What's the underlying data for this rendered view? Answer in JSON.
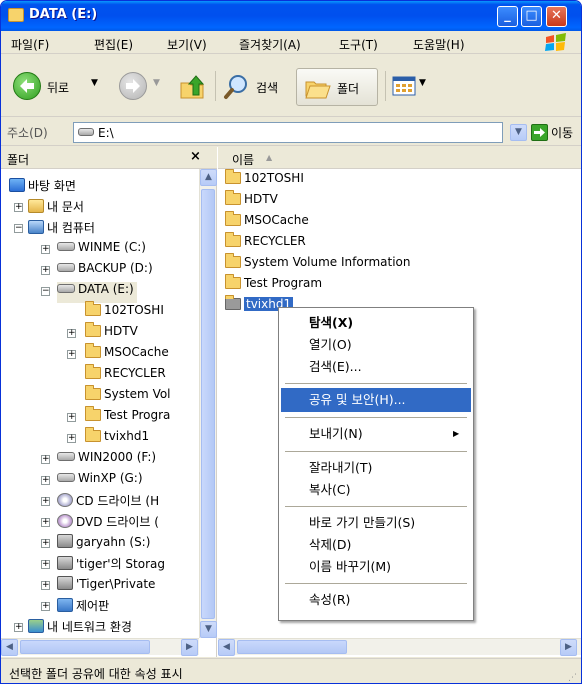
{
  "window": {
    "title": "DATA (E:)"
  },
  "menu": [
    "파일(F)",
    "편집(E)",
    "보기(V)",
    "즐겨찾기(A)",
    "도구(T)",
    "도움말(H)"
  ],
  "toolbar": {
    "back": "뒤로",
    "search": "검색",
    "folders": "폴더"
  },
  "address": {
    "label": "주소(D)",
    "value": "E:\\",
    "go": "이동"
  },
  "folder_pane": {
    "title": "폴더",
    "items": [
      {
        "label": "바탕 화면"
      },
      {
        "label": "내 문서"
      },
      {
        "label": "내 컴퓨터"
      },
      {
        "label": "WINME (C:)"
      },
      {
        "label": "BACKUP (D:)"
      },
      {
        "label": "DATA (E:)"
      },
      {
        "label": "102TOSHI"
      },
      {
        "label": "HDTV"
      },
      {
        "label": "MSOCache"
      },
      {
        "label": "RECYCLER"
      },
      {
        "label": "System Vol"
      },
      {
        "label": "Test Progra"
      },
      {
        "label": "tvixhd1"
      },
      {
        "label": "WIN2000 (F:)"
      },
      {
        "label": "WinXP (G:)"
      },
      {
        "label": "CD 드라이브 (H"
      },
      {
        "label": "DVD 드라이브 ("
      },
      {
        "label": "garyahn (S:)"
      },
      {
        "label": "'tiger'의 Storag"
      },
      {
        "label": "'Tiger\\Private"
      },
      {
        "label": "제어판"
      },
      {
        "label": "내 네트워크 환경"
      }
    ]
  },
  "file_pane": {
    "column_name": "이름",
    "files": [
      "102TOSHI",
      "HDTV",
      "MSOCache",
      "RECYCLER",
      "System Volume Information",
      "Test Program",
      "tvixhd1"
    ]
  },
  "context_menu": {
    "items": [
      "탐색(X)",
      "열기(O)",
      "검색(E)...",
      "공유 및 보안(H)...",
      "보내기(N)",
      "잘라내기(T)",
      "복사(C)",
      "바로 가기 만들기(S)",
      "삭제(D)",
      "이름 바꾸기(M)",
      "속성(R)"
    ]
  },
  "status": {
    "text": "선택한 폴더 공유에 대한 속성 표시"
  },
  "colors": {
    "selection": "#316ac5",
    "titlebar": "#0054e3",
    "folder": "#f7d36b"
  }
}
